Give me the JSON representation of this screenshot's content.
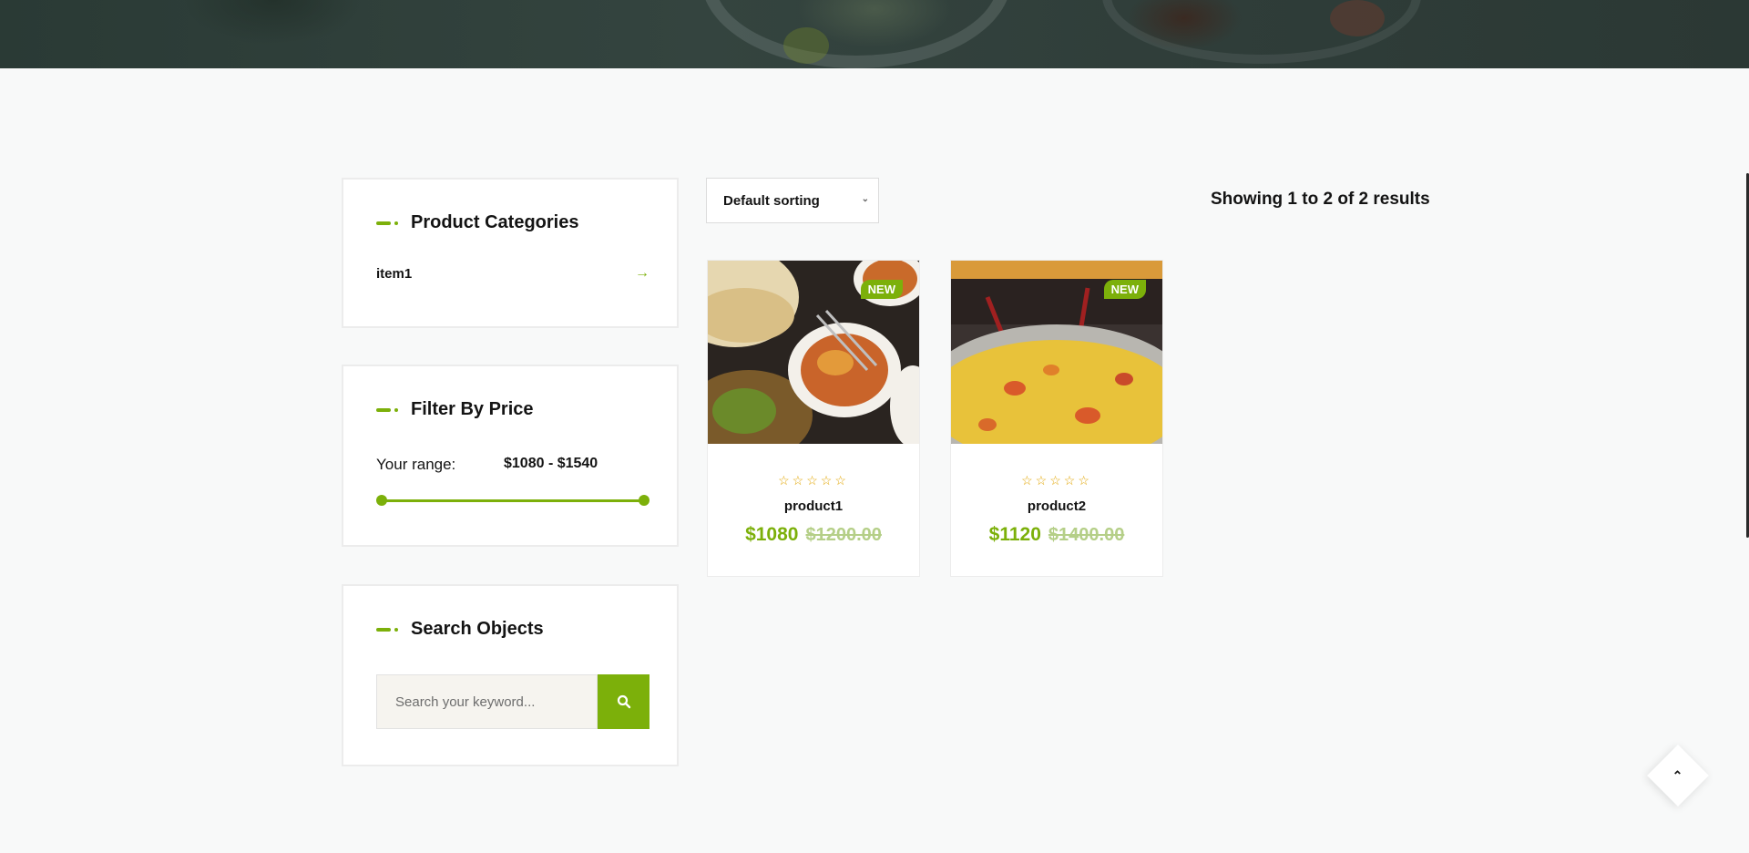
{
  "sidebar": {
    "categories": {
      "title": "Product Categories",
      "items": [
        {
          "label": "item1",
          "arrow": "→"
        }
      ]
    },
    "price_filter": {
      "title": "Filter By Price",
      "range_label": "Your range:",
      "range_value": "$1080 - $1540",
      "min_fraction": 0.0,
      "max_fraction": 1.0
    },
    "search": {
      "title": "Search Objects",
      "placeholder": "Search your keyword...",
      "icon": "search-icon"
    }
  },
  "toolbar": {
    "sort_label": "Default sorting",
    "results": "Showing 1 to 2 of 2 results"
  },
  "products": [
    {
      "badge": "NEW",
      "stars": "☆☆☆☆☆",
      "rating": 0,
      "name": "product1",
      "price": "$1080",
      "old_price": "$1200.00"
    },
    {
      "badge": "NEW",
      "stars": "☆☆☆☆☆",
      "rating": 0,
      "name": "product2",
      "price": "$1120",
      "old_price": "$1400.00"
    }
  ],
  "colors": {
    "accent": "#7cb00a",
    "old_price": "#b5cf88",
    "star": "#e2a500"
  },
  "scroll_top": {
    "icon": "chevron-up-icon",
    "glyph": "⌃"
  }
}
